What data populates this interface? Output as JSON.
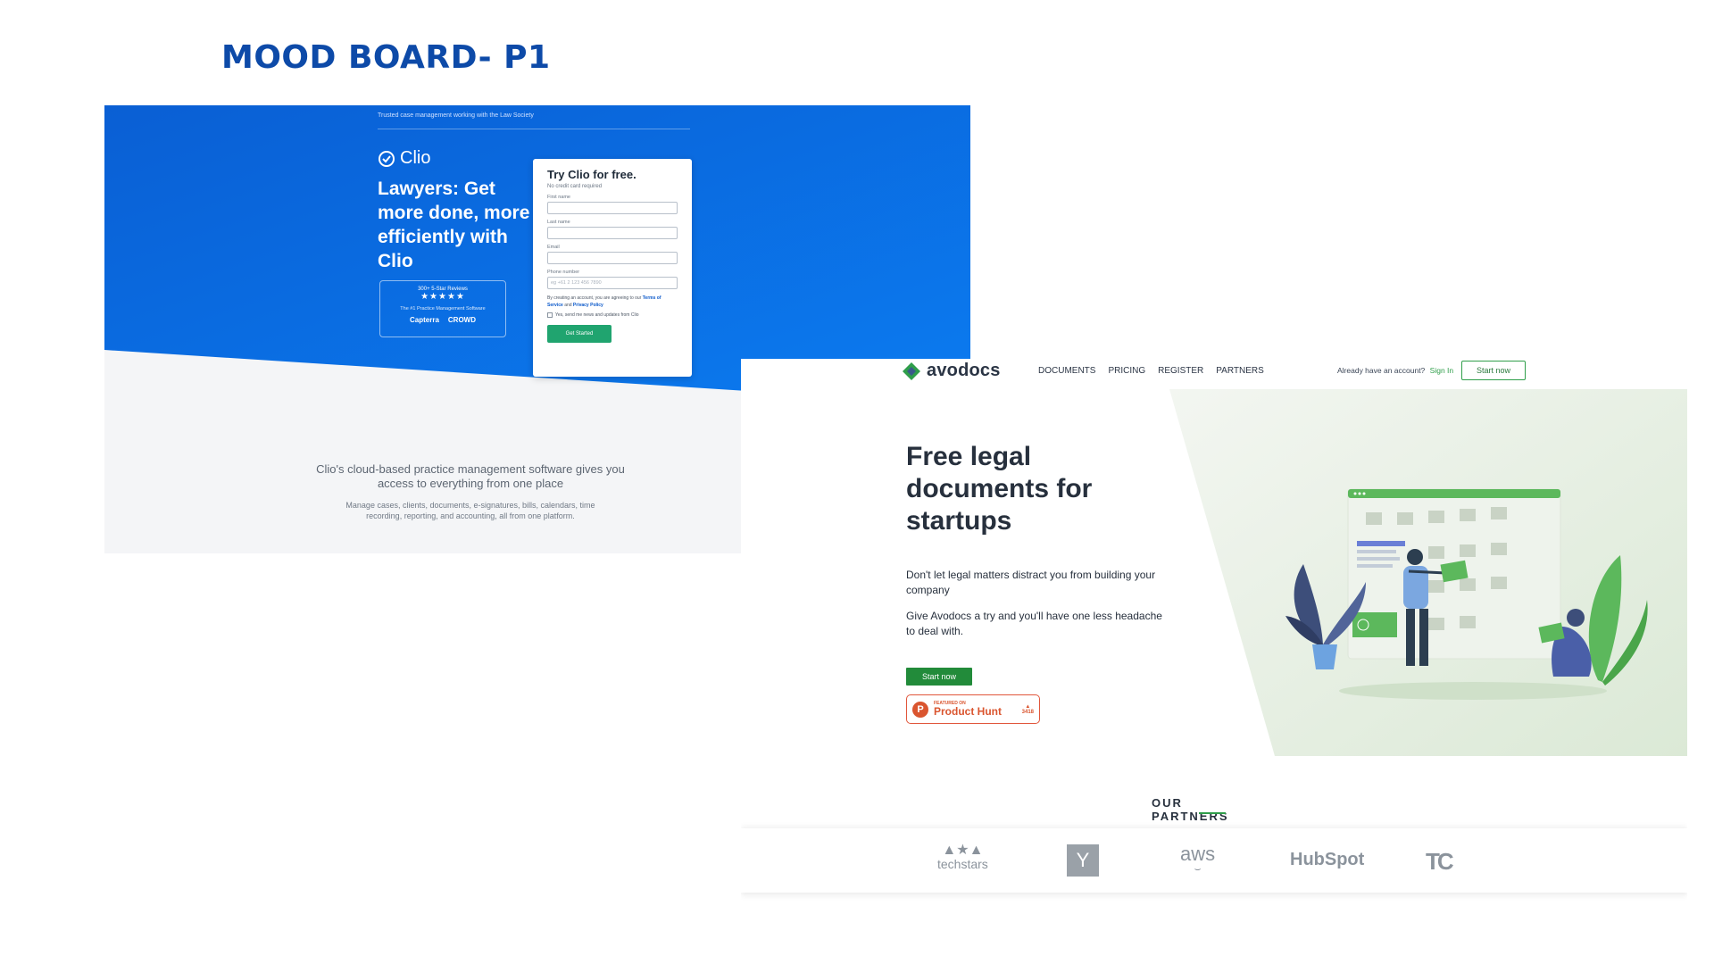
{
  "board": {
    "title": "MOOD BOARD- P1"
  },
  "clio": {
    "top_note": "Trusted case management working with the Law Society",
    "logo": "Clio",
    "headline": "Lawyers: Get more done, more efficiently with Clio",
    "reviews": {
      "count_label": "300+ 5-Star Reviews",
      "stars": "★★★★★",
      "subtitle": "The #1 Practice Management Software",
      "brand1": "Capterra",
      "brand2": "CROWD"
    },
    "form": {
      "title": "Try Clio for free.",
      "subtitle": "No credit card required",
      "first_name_label": "First name",
      "last_name_label": "Last name",
      "email_label": "Email",
      "phone_label": "Phone number",
      "phone_placeholder": "eg +61 2 123 456 7890",
      "terms_prefix": "By creating an account, you are agreeing to our",
      "terms_link": "Terms of Service",
      "terms_and": "and",
      "privacy_link": "Privacy Policy",
      "checkbox_label": "Yes, send me news and updates from Clio",
      "submit": "Get Started"
    },
    "sub_heading": "Clio's cloud-based practice management software gives you access to everything from one place",
    "sub_text": "Manage cases, clients, documents, e-signatures, bills, calendars, time recording, reporting, and accounting, all from one platform.",
    "colors": {
      "blue": "#0a6ee6",
      "green": "#20a46f"
    }
  },
  "avodocs": {
    "logo": "avodocs",
    "nav": [
      "DOCUMENTS",
      "PRICING",
      "REGISTER",
      "PARTNERS"
    ],
    "account_prompt": "Already have an account?",
    "sign_in": "Sign In",
    "start_top": "Start now",
    "headline": "Free legal documents for startups",
    "para1": "Don't let legal matters distract you from building your company",
    "para2": "Give Avodocs a try and you'll have one less headache to deal with.",
    "start_btn": "Start now",
    "product_hunt": {
      "featured": "FEATURED ON",
      "name": "Product Hunt",
      "count": "3418",
      "letter": "P"
    },
    "partners_title": "OUR PARTNERS",
    "partners": [
      "techstars",
      "Y",
      "aws",
      "HubSpot",
      "TC"
    ],
    "colors": {
      "green": "#228b3a",
      "product_hunt": "#da552f"
    }
  }
}
